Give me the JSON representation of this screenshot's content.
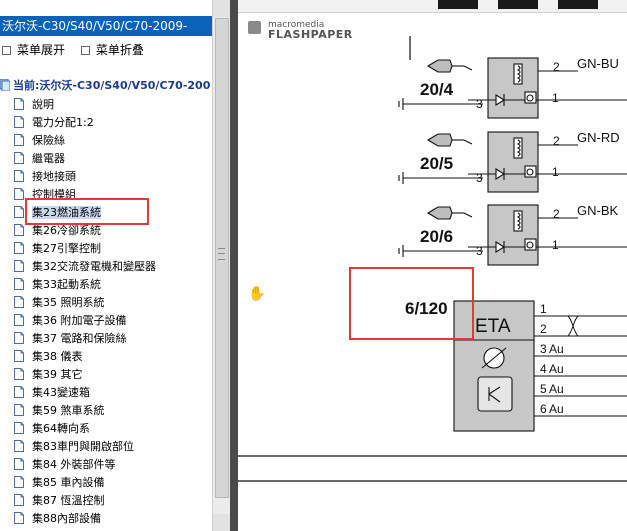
{
  "left": {
    "title": "沃尔沃-C30/S40/V50/C70-2009-",
    "menu": {
      "expand": "菜单展开",
      "collapse": "菜单折叠"
    },
    "root_label": "当前:沃尔沃-C30/S40/V50/C70-200",
    "items": [
      "說明",
      "電力分配1:2",
      "保險絲",
      "繼電器",
      "接地接頭",
      "控制模組",
      "集23燃油系統",
      "集26冷卻系統",
      "集27引擎控制",
      "集32交流發電機和變壓器",
      "集33起動系統",
      "集35 照明系統",
      "集36 附加電子設備",
      "集37 電路和保險絲",
      "集38 儀表",
      "集39 其它",
      "集43變速箱",
      "集59 煞車系統",
      "集64轉向系",
      "集83車門與開啟部位",
      "集84 外裝部件等",
      "集85 車內設備",
      "集87 恆溫控制",
      "集88內部設備"
    ],
    "selected_index": 6
  },
  "doc": {
    "brand_small": "macromedia",
    "brand_big": "FLASHPAPER",
    "relays": [
      {
        "code": "20/4",
        "wire": "GN-BU",
        "pin_top": "2",
        "pin_left": "3",
        "pin_right": "1"
      },
      {
        "code": "20/5",
        "wire": "GN-RD",
        "pin_top": "2",
        "pin_left": "3",
        "pin_right": "1"
      },
      {
        "code": "20/6",
        "wire": "GN-BK",
        "pin_top": "2",
        "pin_left": "3",
        "pin_right": "1"
      }
    ],
    "module": {
      "code": "6/120",
      "name": "ETA",
      "pins": [
        {
          "n": "1",
          "label": ""
        },
        {
          "n": "2",
          "label": ""
        },
        {
          "n": "3",
          "label": "Au"
        },
        {
          "n": "4",
          "label": "Au"
        },
        {
          "n": "5",
          "label": "Au"
        },
        {
          "n": "6",
          "label": "Au"
        }
      ]
    }
  }
}
